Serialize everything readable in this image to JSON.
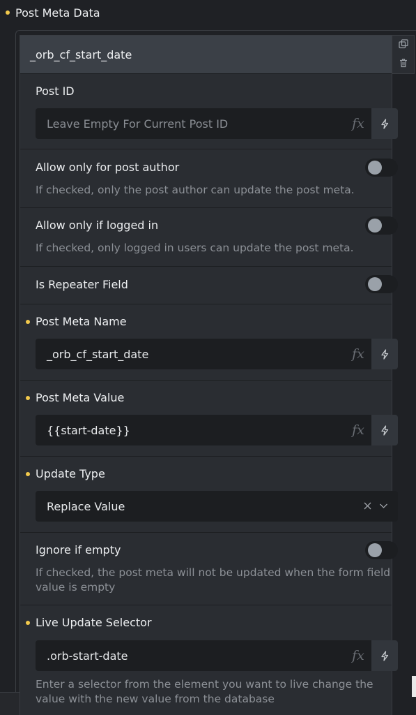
{
  "section": {
    "title": "Post Meta Data"
  },
  "item": {
    "header": "_orb_cf_start_date"
  },
  "fields": {
    "post_id": {
      "label": "Post ID",
      "placeholder": "Leave Empty For Current Post ID"
    },
    "allow_author": {
      "label": "Allow only for post author",
      "desc": "If checked, only the post author can update the post meta.",
      "checked": false
    },
    "allow_logged": {
      "label": "Allow only if logged in",
      "desc": "If checked, only logged in users can update the post meta.",
      "checked": false
    },
    "repeater": {
      "label": "Is Repeater Field",
      "checked": false
    },
    "meta_name": {
      "label": "Post Meta Name",
      "value": "_orb_cf_start_date"
    },
    "meta_value": {
      "label": "Post Meta Value",
      "value": "{{start-date}}"
    },
    "update_type": {
      "label": "Update Type",
      "value": "Replace Value"
    },
    "ignore_empty": {
      "label": "Ignore if empty",
      "desc": "If checked, the post meta will not be updated when the form field value is empty",
      "checked": false
    },
    "live_selector": {
      "label": "Live Update Selector",
      "value": ".orb-start-date",
      "desc": "Enter a selector from the element you want to live change the value with the new value from the database"
    }
  },
  "fx_label": "fx",
  "colors": {
    "required_dot": "#f2c94c",
    "panel": "#2a2d32",
    "header": "#3b4047",
    "input": "#1c1e21"
  },
  "icons": [
    "duplicate-icon",
    "trash-icon",
    "fx-icon",
    "bolt-icon",
    "clear-x-icon",
    "chevron-down-icon"
  ]
}
